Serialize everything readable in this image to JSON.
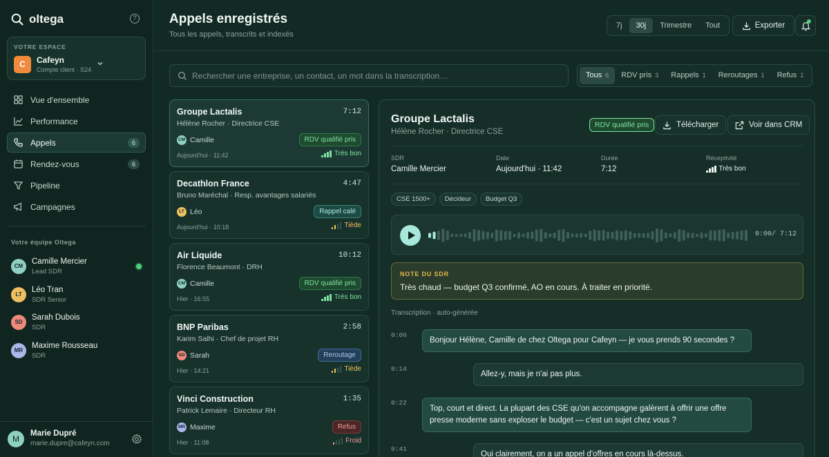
{
  "app": {
    "name": "oltega",
    "help": "?"
  },
  "workspace": {
    "caption": "VOTRE ESPACE",
    "initial": "C",
    "name": "Cafeyn",
    "sub": "Compte client · S24"
  },
  "nav": [
    {
      "label": "Vue d'ensemble",
      "icon": "grid-icon",
      "badge": ""
    },
    {
      "label": "Performance",
      "icon": "chart-icon",
      "badge": ""
    },
    {
      "label": "Appels",
      "icon": "phone-icon",
      "badge": "6"
    },
    {
      "label": "Rendez-vous",
      "icon": "calendar-icon",
      "badge": "6"
    },
    {
      "label": "Pipeline",
      "icon": "funnel-icon",
      "badge": ""
    },
    {
      "label": "Campagnes",
      "icon": "megaphone-icon",
      "badge": ""
    }
  ],
  "team": {
    "caption": "Votre équipe Oltega",
    "members": [
      {
        "initials": "CM",
        "name": "Camille Mercier",
        "role": "Lead SDR",
        "color": "#8fd1c0"
      },
      {
        "initials": "LT",
        "name": "Léo Tran",
        "role": "SDR Senior",
        "color": "#f0c060"
      },
      {
        "initials": "SD",
        "name": "Sarah Dubois",
        "role": "SDR",
        "color": "#ef8a7a"
      },
      {
        "initials": "MR",
        "name": "Maxime Rousseau",
        "role": "SDR",
        "color": "#a9b8e8"
      }
    ]
  },
  "user": {
    "initial": "M",
    "name": "Marie Dupré",
    "email": "marie.dupre@cafeyn.com"
  },
  "header": {
    "title": "Appels enregistrés",
    "subtitle": "Tous les appels, transcrits et indexés"
  },
  "period": {
    "options": [
      "7j",
      "30j",
      "Trimestre",
      "Tout"
    ],
    "selected": "30j"
  },
  "export_label": "Exporter",
  "search": {
    "placeholder": "Rechercher une entreprise, un contact, un mot dans la transcription…"
  },
  "filters": [
    {
      "label": "Tous",
      "count": "6"
    },
    {
      "label": "RDV pris",
      "count": "3"
    },
    {
      "label": "Rappels",
      "count": "1"
    },
    {
      "label": "Reroutages",
      "count": "1"
    },
    {
      "label": "Refus",
      "count": "1"
    }
  ],
  "calls": [
    {
      "company": "Groupe Lactalis",
      "duration": "7:12",
      "contact": "Hélène Rocher · Directrice CSE",
      "sdr_initials": "CM",
      "sdr": "Camille",
      "sdr_color": "#8fd1c0",
      "status": "RDV qualifié pris",
      "status_kind": "green",
      "time": "Aujourd'hui · 11:42",
      "receptivity": "Très bon",
      "level": 4
    },
    {
      "company": "Decathlon France",
      "duration": "4:47",
      "contact": "Bruno Maréchal · Resp. avantages salariés",
      "sdr_initials": "LT",
      "sdr": "Léo",
      "sdr_color": "#f0c060",
      "status": "Rappel calé",
      "status_kind": "teal",
      "time": "Aujourd'hui · 10:18",
      "receptivity": "Tiède",
      "level": 2
    },
    {
      "company": "Air Liquide",
      "duration": "10:12",
      "contact": "Florence Beaumont · DRH",
      "sdr_initials": "CM",
      "sdr": "Camille",
      "sdr_color": "#8fd1c0",
      "status": "RDV qualifié pris",
      "status_kind": "green",
      "time": "Hier · 16:55",
      "receptivity": "Très bon",
      "level": 4
    },
    {
      "company": "BNP Paribas",
      "duration": "2:58",
      "contact": "Karim Salhi · Chef de projet RH",
      "sdr_initials": "SD",
      "sdr": "Sarah",
      "sdr_color": "#ef8a7a",
      "status": "Reroutage",
      "status_kind": "blue",
      "time": "Hier · 14:21",
      "receptivity": "Tiède",
      "level": 2
    },
    {
      "company": "Vinci Construction",
      "duration": "1:35",
      "contact": "Patrick Lemaire · Directeur RH",
      "sdr_initials": "MR",
      "sdr": "Maxime",
      "sdr_color": "#a9b8e8",
      "status": "Refus",
      "status_kind": "red",
      "time": "Hier · 11:08",
      "receptivity": "Froid",
      "level": 1
    }
  ],
  "detail": {
    "company": "Groupe Lactalis",
    "contact": "Hélène Rocher · Directrice CSE",
    "status": "RDV qualifié pris",
    "download_label": "Télécharger",
    "crm_label": "Voir dans CRM",
    "meta": [
      {
        "key": "SDR",
        "value": "Camille Mercier"
      },
      {
        "key": "Date",
        "value": "Aujourd'hui · 11:42"
      },
      {
        "key": "Durée",
        "value": "7:12"
      },
      {
        "key": "Réceptivité",
        "value": "Très bon"
      }
    ],
    "tags": [
      "CSE 1500+",
      "Décideur",
      "Budget Q3"
    ],
    "player": {
      "current": "0:00",
      "total": "/ 7:12",
      "progress": 0.02
    },
    "note": {
      "caption": "NOTE DU SDR",
      "text": "Très chaud — budget Q3 confirmé, AO en cours. À traiter en priorité."
    },
    "transcript_caption": "Transcription · auto-générée",
    "transcript": [
      {
        "t": "0:06",
        "speaker": "sdr",
        "text": "Bonjour Hélène, Camille de chez Oltega pour Cafeyn — je vous prends 90 secondes ?"
      },
      {
        "t": "0:14",
        "speaker": "prospect",
        "text": "Allez-y, mais je n'ai pas plus."
      },
      {
        "t": "0:22",
        "speaker": "sdr",
        "text": "Top, court et direct. La plupart des CSE qu'on accompagne galèrent à offrir une offre presse moderne sans exploser le budget — c'est un sujet chez vous ?"
      },
      {
        "t": "0:41",
        "speaker": "prospect",
        "text": "Oui clairement, on a un appel d'offres en cours là-dessus."
      }
    ]
  },
  "colors": {
    "accent": "#a8e8dc",
    "hot": "#7fe2a0",
    "warm": "#f0c060",
    "cold": "#f29c9c"
  }
}
